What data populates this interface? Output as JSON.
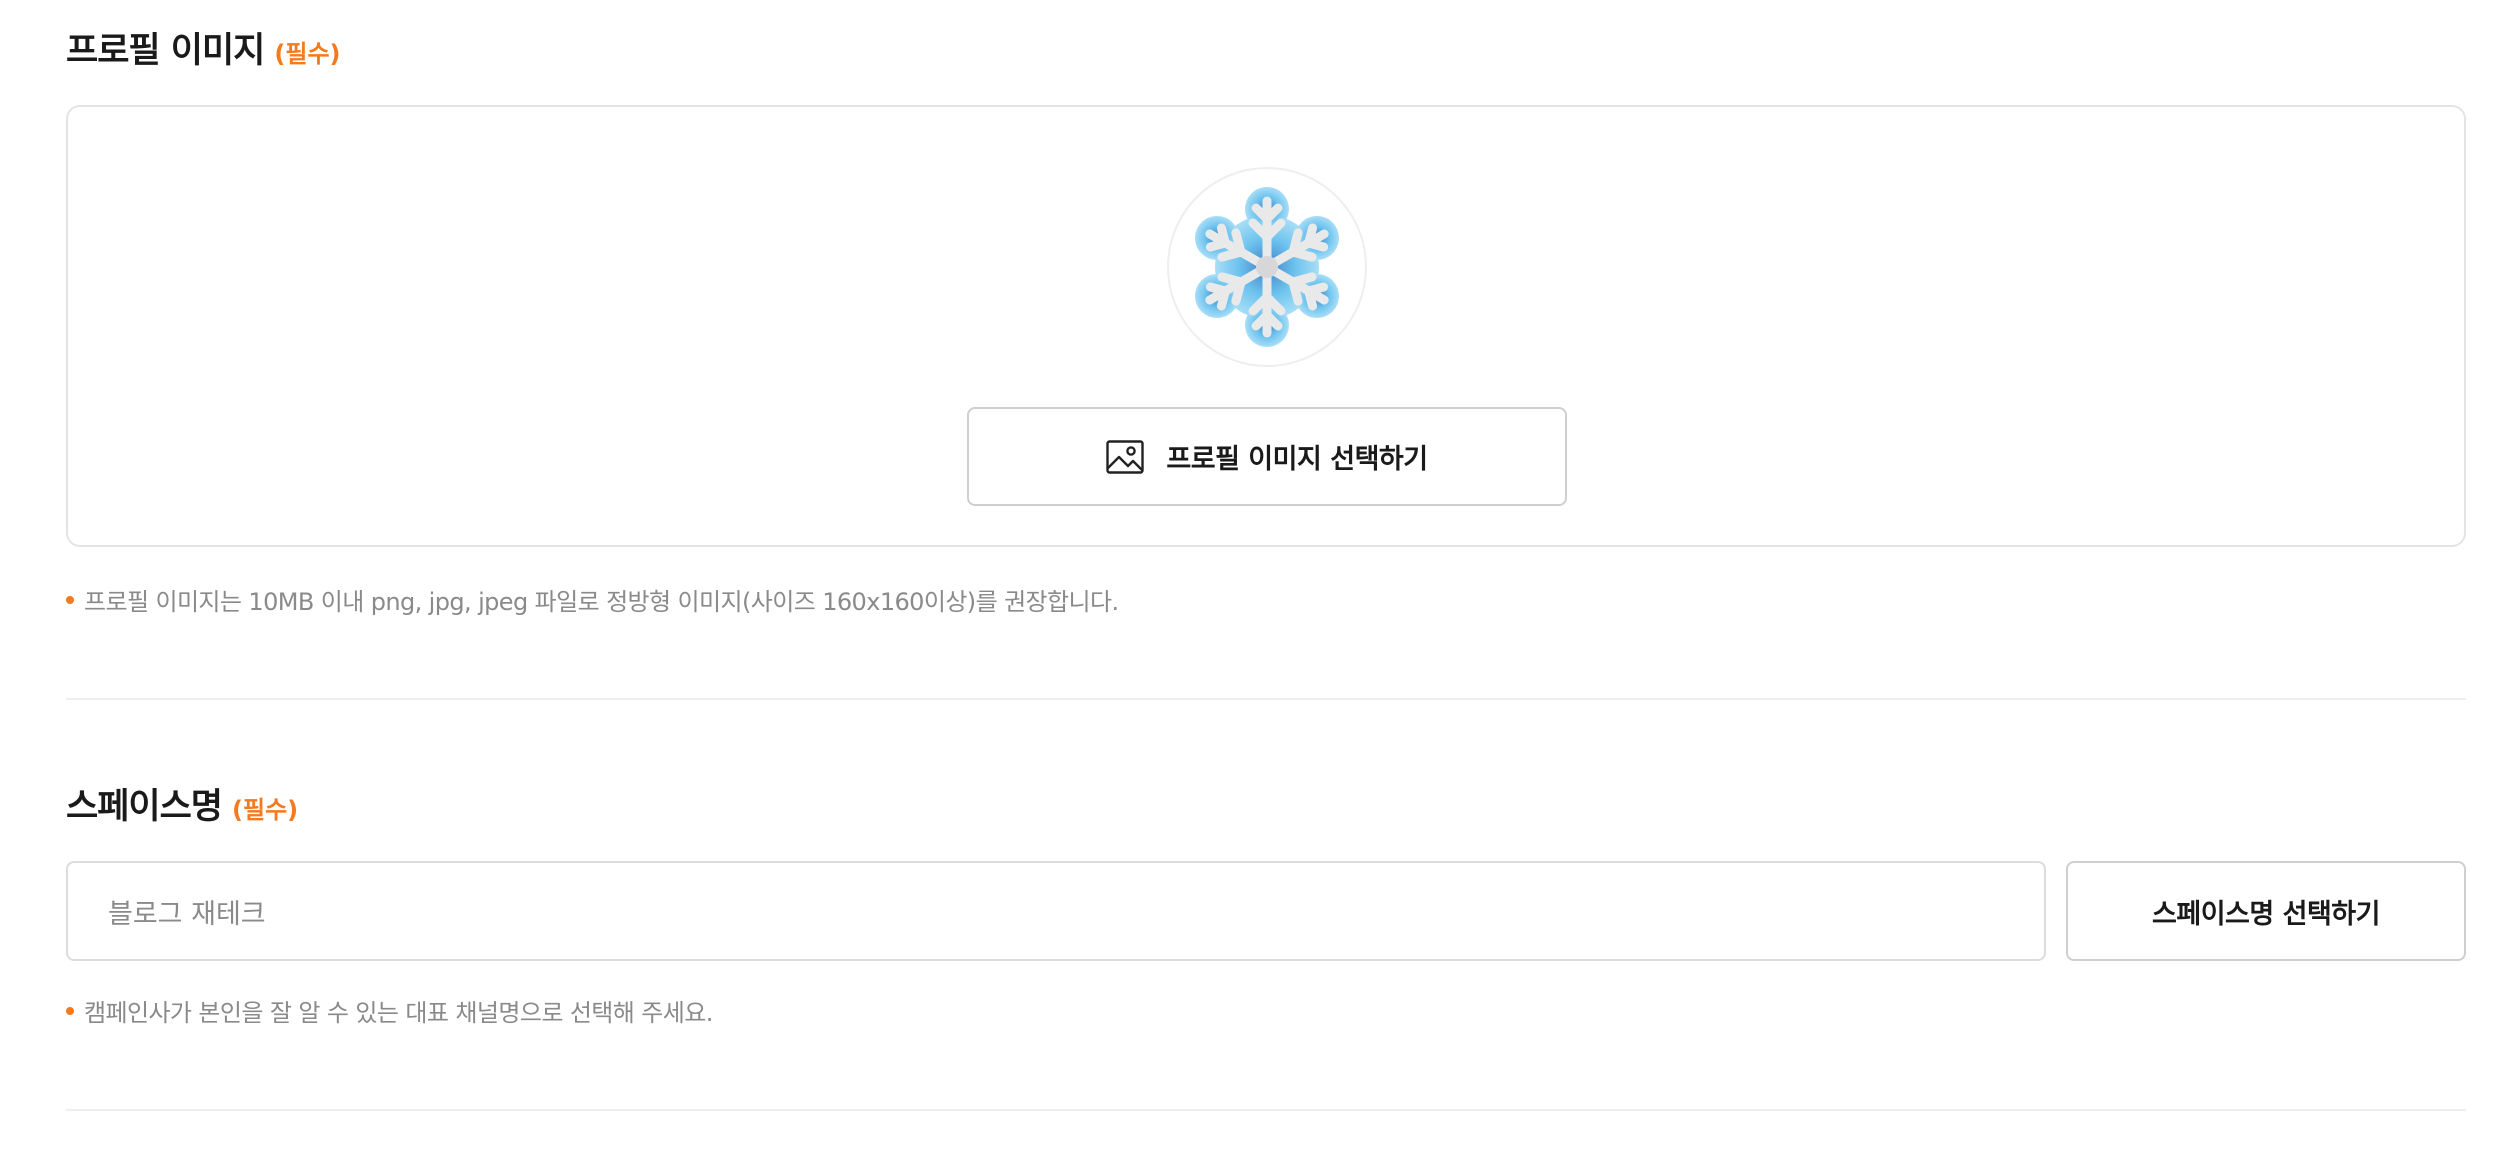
{
  "profile_image": {
    "title": "프로필 이미지",
    "required": "(필수)",
    "avatar_icon": "snowflake-icon",
    "select_button_icon": "image-icon",
    "select_button_label": "프로필 이미지 선택하기",
    "note": "프로필 이미지는 10MB 이내 png, jpg, jpeg 파일로 정방형 이미지(사이즈 160x160이상)를 권장합니다."
  },
  "space_name": {
    "title": "스페이스명",
    "required": "(필수)",
    "input_value": "블로그 재테크",
    "select_button_label": "스페이스명 선택하기",
    "note": "캠페인사가 본인을 잘 알 수 있는 대표 채널명으로 선택해 주세요."
  },
  "colors": {
    "accent": "#f47a20",
    "border": "#dcdcdc",
    "muted_text": "#8a8a8a"
  }
}
